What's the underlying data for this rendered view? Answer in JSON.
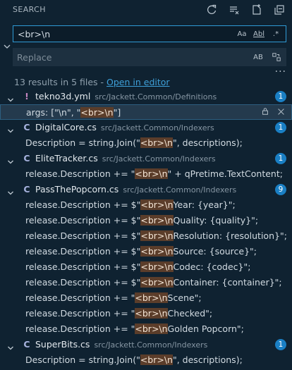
{
  "header": {
    "title": "SEARCH"
  },
  "search": {
    "value": "<br>\\n",
    "match_case": "Aa",
    "whole_word": "Abl",
    "regex": ".*",
    "replace_placeholder": "Replace",
    "preserve_case": "AB"
  },
  "summary": {
    "text": "13 results in 5 files - ",
    "link": "Open in editor"
  },
  "files": [
    {
      "name": "tekno3d.yml",
      "path": "src/Jackett.Common/Definitions",
      "count": "1",
      "icon": "exclamation-icon",
      "matches": [
        {
          "pre": "args: [\"\\n\", \"",
          "hit": "<br>\\n",
          "post": "\"]"
        }
      ]
    },
    {
      "name": "DigitalCore.cs",
      "path": "src/Jackett.Common/Indexers",
      "count": "1",
      "icon": "csharp-icon",
      "matches": [
        {
          "pre": "Description = string.Join(\"",
          "hit": "<br>\\n",
          "post": "\", descriptions);"
        }
      ]
    },
    {
      "name": "EliteTracker.cs",
      "path": "src/Jackett.Common/Indexers",
      "count": "1",
      "icon": "csharp-icon",
      "matches": [
        {
          "pre": "release.Description += \"",
          "hit": "<br>\\n",
          "post": "\" + qPretime.TextContent;"
        }
      ]
    },
    {
      "name": "PassThePopcorn.cs",
      "path": "src/Jackett.Common/Indexers",
      "count": "9",
      "icon": "csharp-icon",
      "matches": [
        {
          "pre": "release.Description += $\"",
          "hit": "<br>\\n",
          "post": "Year: {year}\";"
        },
        {
          "pre": "release.Description += $\"",
          "hit": "<br>\\n",
          "post": "Quality: {quality}\";"
        },
        {
          "pre": "release.Description += $\"",
          "hit": "<br>\\n",
          "post": "Resolution: {resolution}\";"
        },
        {
          "pre": "release.Description += $\"",
          "hit": "<br>\\n",
          "post": "Source: {source}\";"
        },
        {
          "pre": "release.Description += $\"",
          "hit": "<br>\\n",
          "post": "Codec: {codec}\";"
        },
        {
          "pre": "release.Description += $\"",
          "hit": "<br>\\n",
          "post": "Container: {container}\";"
        },
        {
          "pre": "release.Description += \"",
          "hit": "<br>\\n",
          "post": "Scene\";"
        },
        {
          "pre": "release.Description += \"",
          "hit": "<br>\\n",
          "post": "Checked\";"
        },
        {
          "pre": "release.Description += \"",
          "hit": "<br>\\n",
          "post": "Golden Popcorn\";"
        }
      ]
    },
    {
      "name": "SuperBits.cs",
      "path": "src/Jackett.Common/Indexers",
      "count": "1",
      "icon": "csharp-icon",
      "matches": [
        {
          "pre": "Description = string.Join(\"",
          "hit": "<br>\\n",
          "post": "\", descriptions);"
        }
      ]
    }
  ],
  "colors": {
    "accent": "#2f9bd6",
    "highlight": "#5b3d2a",
    "badge": "#1a7fc4",
    "background": "#0f2231"
  }
}
